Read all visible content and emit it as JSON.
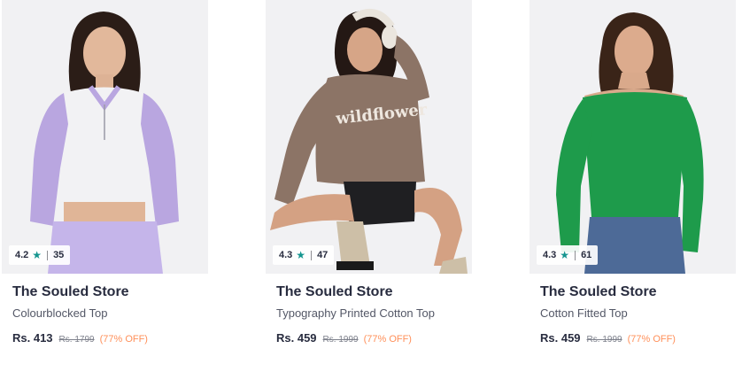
{
  "products": [
    {
      "brand": "The Souled Store",
      "name": "Colourblocked Top",
      "price": "Rs. 413",
      "mrp": "Rs. 1799",
      "discount": "(77% OFF)",
      "rating": "4.2",
      "rating_count": "35",
      "image_desc": "woman-in-lavender-white-colourblocked-top",
      "top_color": "#b9a6e0",
      "accent_color": "#f2f2f4"
    },
    {
      "brand": "The Souled Store",
      "name": "Typography Printed Cotton Top",
      "price": "Rs. 459",
      "mrp": "Rs. 1999",
      "discount": "(77% OFF)",
      "rating": "4.3",
      "rating_count": "47",
      "image_desc": "woman-in-brown-wildflower-printed-top",
      "top_color": "#8c7466",
      "print_text": "wildflower"
    },
    {
      "brand": "The Souled Store",
      "name": "Cotton Fitted Top",
      "price": "Rs. 459",
      "mrp": "Rs. 1999",
      "discount": "(77% OFF)",
      "rating": "4.3",
      "rating_count": "61",
      "image_desc": "woman-in-green-off-shoulder-top",
      "top_color": "#1e9b4b"
    }
  ],
  "icons": {
    "rating_star": "star-icon"
  },
  "colors": {
    "rating_star": "#14958f",
    "discount": "#ff905a",
    "brand": "#282c3f"
  }
}
